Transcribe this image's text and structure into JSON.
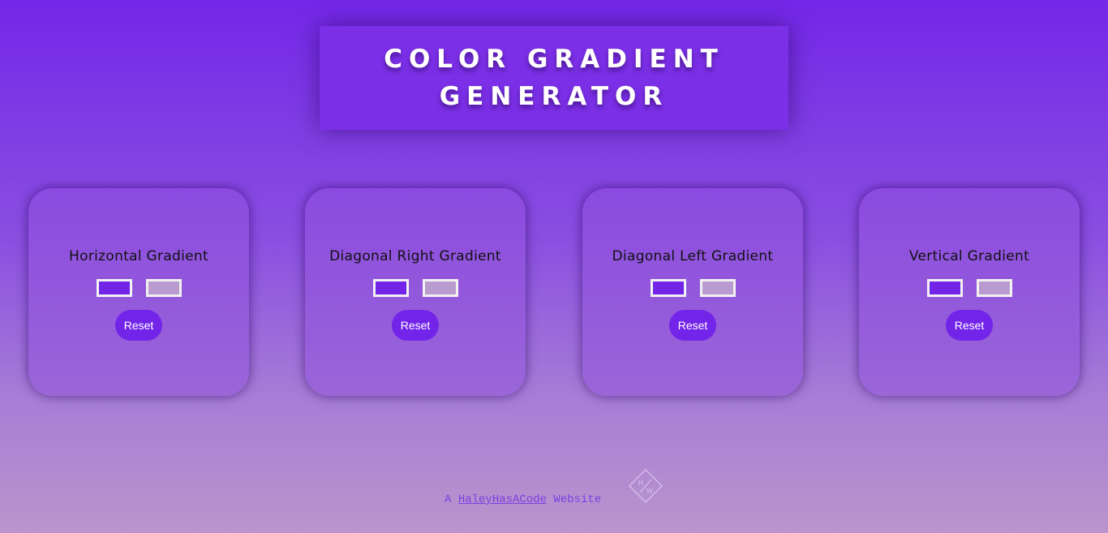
{
  "header": {
    "title_line1": "COLOR GRADIENT",
    "title_line2": "GENERATOR"
  },
  "cards": [
    {
      "title": "Horizontal Gradient",
      "reset_label": "Reset",
      "color1": "#7324e9",
      "color2": "#b99bcf"
    },
    {
      "title": "Diagonal Right Gradient",
      "reset_label": "Reset",
      "color1": "#7324e9",
      "color2": "#b99bcf"
    },
    {
      "title": "Diagonal Left Gradient",
      "reset_label": "Reset",
      "color1": "#7324e9",
      "color2": "#b99bcf"
    },
    {
      "title": "Vertical Gradient",
      "reset_label": "Reset",
      "color1": "#7324e9",
      "color2": "#b99bcf"
    }
  ],
  "footer": {
    "prefix": "A ",
    "link_text": "HaleyHasACode",
    "suffix": " Website"
  },
  "logo": {
    "icon": "hw-diamond-logo-icon",
    "text_top": "H",
    "text_bottom": "W"
  },
  "colors": {
    "accent": "#7324e9",
    "header_bg": "#7b2fe6",
    "footer_text": "#7a3fe0"
  }
}
